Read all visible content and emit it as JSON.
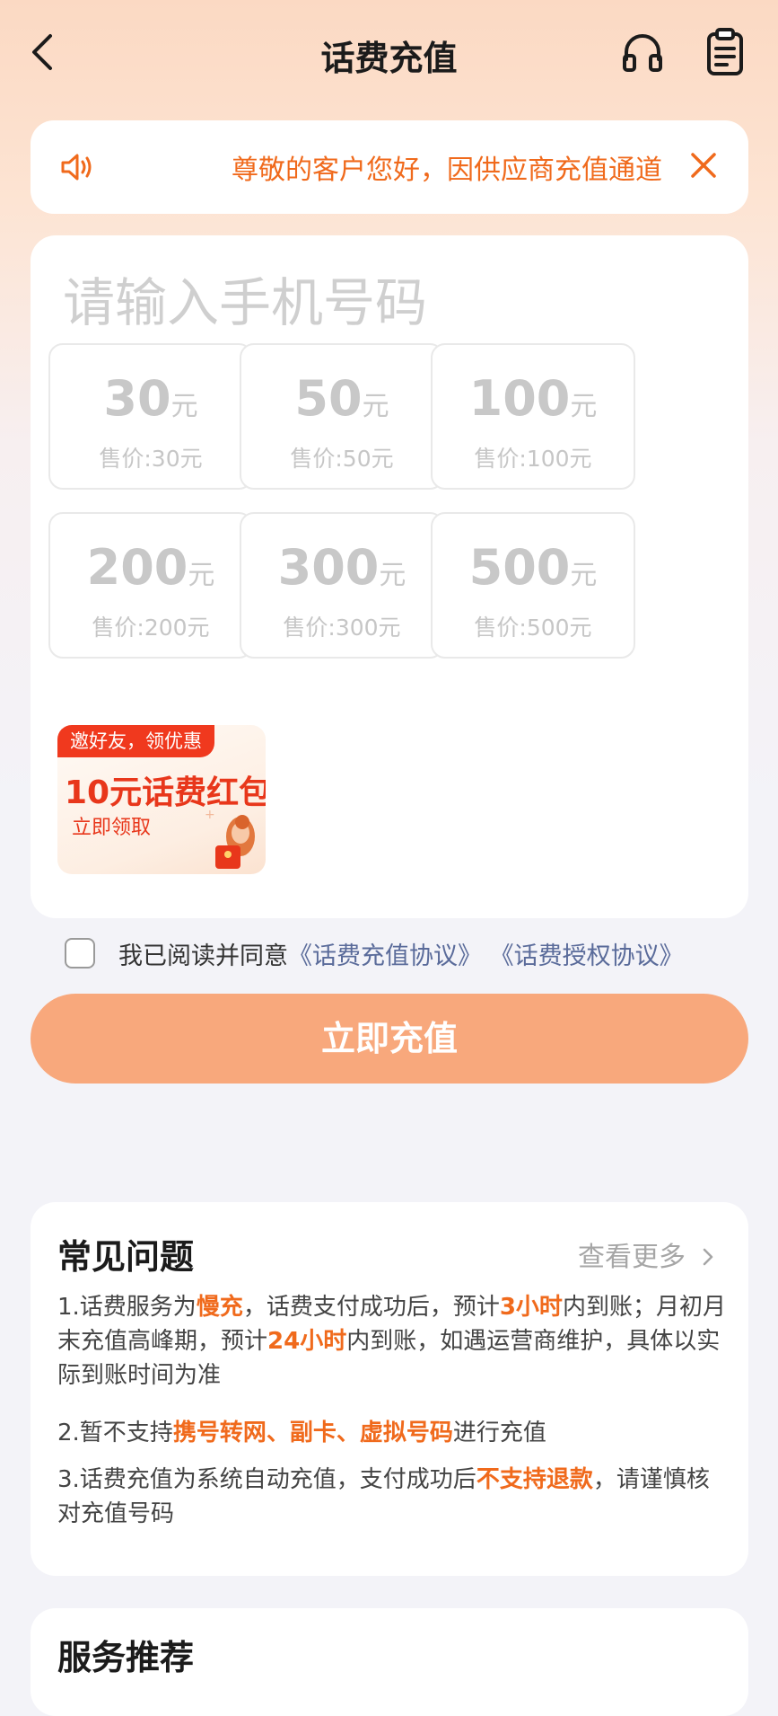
{
  "header": {
    "title": "话费充值"
  },
  "notice": {
    "text": "尊敬的客户您好，因供应商充值通道"
  },
  "recharge": {
    "phone_placeholder": "请输入手机号码",
    "unit": "元",
    "options": [
      {
        "amount": "30",
        "price": "售价:30元"
      },
      {
        "amount": "50",
        "price": "售价:50元"
      },
      {
        "amount": "100",
        "price": "售价:100元"
      },
      {
        "amount": "200",
        "price": "售价:200元"
      },
      {
        "amount": "300",
        "price": "售价:300元"
      },
      {
        "amount": "500",
        "price": "售价:500元"
      }
    ]
  },
  "promo": {
    "tag": "邀好友，领优惠",
    "title": "10元话费红包",
    "cta": "立即领取"
  },
  "agreement": {
    "text": "我已阅读并同意",
    "link1": "《话费充值协议》",
    "link2": "《话费授权协议》"
  },
  "submit_label": "立即充值",
  "faq": {
    "title": "常见问题",
    "more": "查看更多",
    "items": [
      [
        {
          "t": "1.话费服务为",
          "h": false
        },
        {
          "t": "慢充",
          "h": true
        },
        {
          "t": "，话费支付成功后，预计",
          "h": false
        },
        {
          "t": "3小时",
          "h": true
        },
        {
          "t": "内到账；月初月末充值高峰期，预计",
          "h": false
        },
        {
          "t": "24小时",
          "h": true
        },
        {
          "t": "内到账，如遇运营商维护，具体以实际到账时间为准",
          "h": false
        }
      ],
      [
        {
          "t": "2.暂不支持",
          "h": false
        },
        {
          "t": "携号转网、副卡、虚拟号码",
          "h": true
        },
        {
          "t": "进行充值",
          "h": false
        }
      ],
      [
        {
          "t": "3.话费充值为系统自动充值，支付成功后",
          "h": false
        },
        {
          "t": "不支持退款",
          "h": true
        },
        {
          "t": "，请谨慎核对充值号码",
          "h": false
        }
      ]
    ]
  },
  "services": {
    "title": "服务推荐"
  },
  "colors": {
    "accent": "#f06a1c",
    "button": "#f8a87c",
    "promo_red": "#e8371b"
  },
  "icons": {
    "back": "chevron-left-icon",
    "support": "headset-icon",
    "orders": "clipboard-icon",
    "speaker": "speaker-icon",
    "close": "close-icon"
  }
}
